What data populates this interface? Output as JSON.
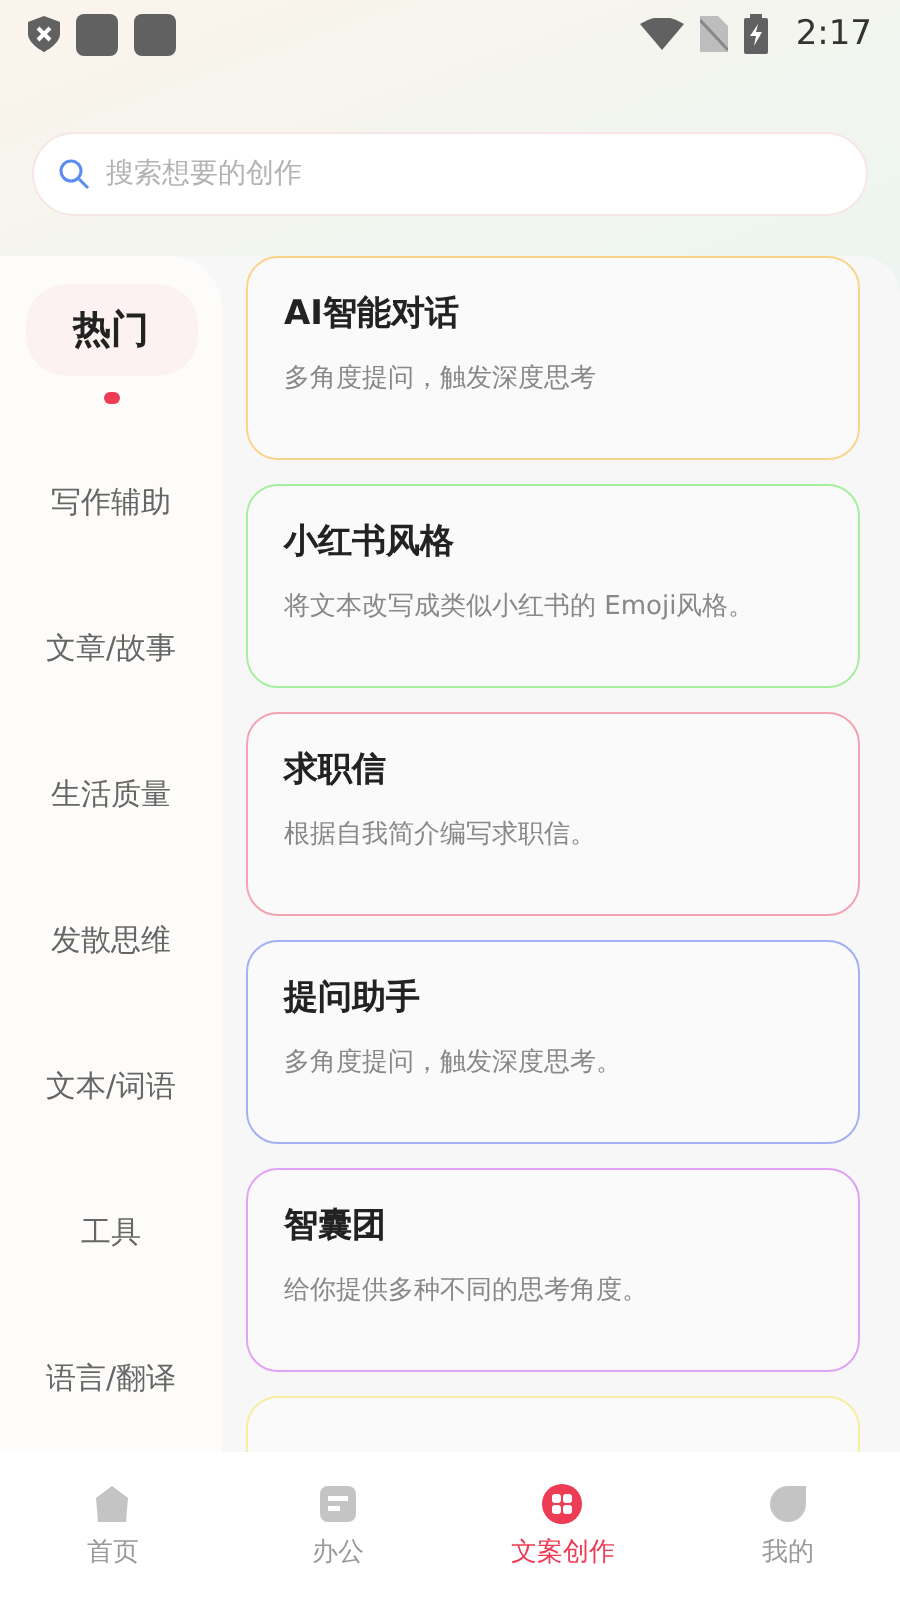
{
  "status_bar": {
    "time": "2:17"
  },
  "search": {
    "placeholder": "搜索想要的创作"
  },
  "categories": [
    {
      "label": "热门",
      "selected": true
    },
    {
      "label": "写作辅助",
      "selected": false
    },
    {
      "label": "文章/故事",
      "selected": false
    },
    {
      "label": "生活质量",
      "selected": false
    },
    {
      "label": "发散思维",
      "selected": false
    },
    {
      "label": "文本/词语",
      "selected": false
    },
    {
      "label": "工具",
      "selected": false
    },
    {
      "label": "语言/翻译",
      "selected": false
    }
  ],
  "cards": [
    {
      "title": "AI智能对话",
      "description": "多角度提问，触发深度思考",
      "color": "#fbd48c"
    },
    {
      "title": "小红书风格",
      "description": "将文本改写成类似小红书的 Emoji风格。",
      "color": "#a6efa0"
    },
    {
      "title": "求职信",
      "description": "根据自我简介编写求职信。",
      "color": "#f4a3b2"
    },
    {
      "title": "提问助手",
      "description": "多角度提问，触发深度思考。",
      "color": "#a3b0f4"
    },
    {
      "title": "智囊团",
      "description": "给你提供多种不同的思考角度。",
      "color": "#e2a3f6"
    },
    {
      "color": "#f5ee9c"
    }
  ],
  "tabs": [
    {
      "label": "首页",
      "kind": "home",
      "selected": false
    },
    {
      "label": "办公",
      "kind": "office",
      "selected": false
    },
    {
      "label": "文案创作",
      "kind": "create",
      "selected": true
    },
    {
      "label": "我的",
      "kind": "me",
      "selected": false
    }
  ]
}
